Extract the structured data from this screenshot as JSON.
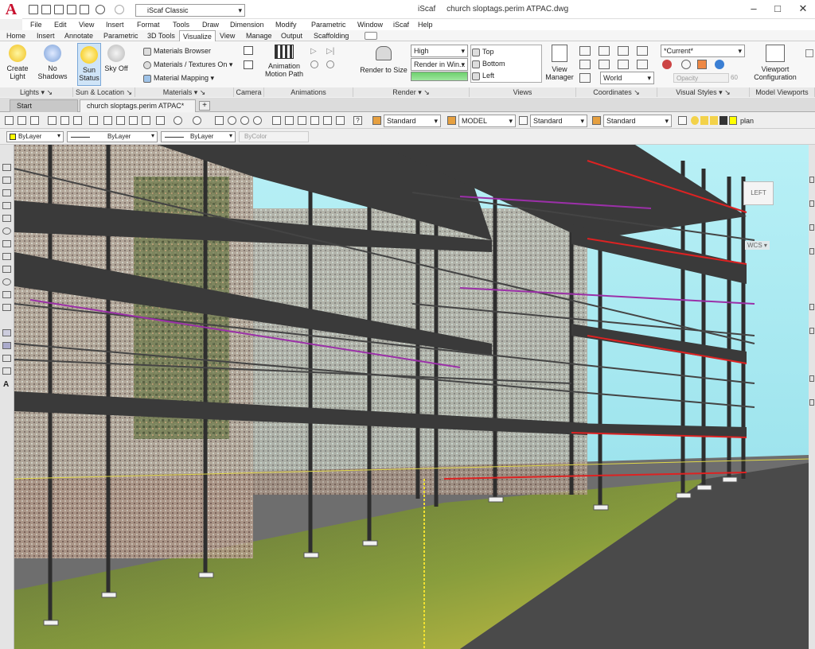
{
  "app": {
    "logo_letter": "A",
    "title": "iScaf",
    "file": "church sloptags.perim ATPAC.dwg",
    "workspace": "iScaf Classic"
  },
  "window_buttons": [
    "–",
    "□",
    "✕"
  ],
  "menu": [
    "File",
    "Edit",
    "View",
    "Insert",
    "Format",
    "Tools",
    "Draw",
    "Dimension",
    "Modify",
    "Parametric",
    "Window",
    "iScaf",
    "Help"
  ],
  "ribbon_tabs": [
    "Home",
    "Insert",
    "Annotate",
    "Parametric",
    "3D Tools",
    "Visualize",
    "View",
    "Manage",
    "Output",
    "Scaffolding"
  ],
  "active_tab": "Visualize",
  "lights": {
    "create": "Create\nLight",
    "no_shadows": "No\nShadows",
    "sun_status": "Sun\nStatus",
    "sky_off": "Sky Off"
  },
  "materials": {
    "browser": "Materials Browser",
    "textures": "Materials / Textures On",
    "mapping": "Material Mapping"
  },
  "animations": {
    "motion_path": "Animation\nMotion Path"
  },
  "render": {
    "quality": "High",
    "render_in": "Render in Win...",
    "render_to_size": "Render to Size"
  },
  "views": {
    "top": "Top",
    "bottom": "Bottom",
    "left": "Left",
    "view_manager": "View\nManager"
  },
  "coordinates": {
    "world": "World"
  },
  "visual_styles": {
    "current": "*Current*",
    "opacity": "Opacity",
    "opacity_val": "60"
  },
  "viewports": {
    "config": "Viewport\nConfiguration"
  },
  "panels": [
    "Lights",
    "Sun & Location",
    "Materials",
    "Camera",
    "Animations",
    "Render",
    "Views",
    "Coordinates",
    "Visual Styles",
    "Model Viewports"
  ],
  "doc_tabs": [
    "Start",
    "church sloptags.perim ATPAC*"
  ],
  "toolbar1": {
    "text_style": "Standard",
    "dim_style": "MODEL",
    "table_style": "Standard",
    "mleader_style": "Standard",
    "layer": "plan"
  },
  "toolbar2": {
    "color": "ByLayer",
    "linetype": "ByLayer",
    "lineweight": "ByLayer",
    "plotstyle": "ByColor"
  },
  "viewcube": {
    "face": "LEFT",
    "ucs": "WCS"
  },
  "colors": {
    "accent": "#c8102e",
    "sky": "#9fe2ee"
  }
}
